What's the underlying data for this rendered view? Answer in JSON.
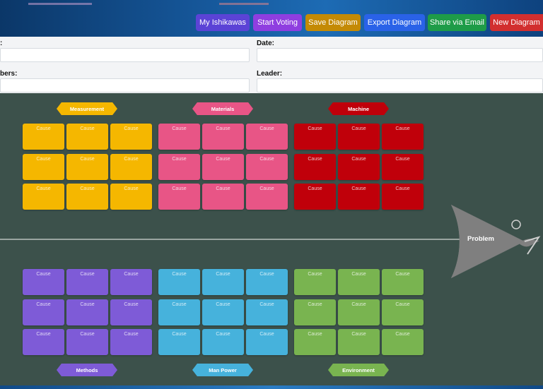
{
  "toolbar": {
    "my_ishikawas": "My Ishikawas",
    "start_voting": "Start Voting",
    "save_diagram": "Save Diagram",
    "export_diagram": "Export Diagram",
    "share_email": "Share via Email",
    "new_diagram": "New Diagram"
  },
  "form": {
    "date_label": "Date:",
    "leader_label": "Leader:",
    "members_label": "bers:",
    "cut_label": ":"
  },
  "categories": {
    "measurement": "Measurement",
    "materials": "Materials",
    "machine": "Machine",
    "methods": "Methods",
    "man_power": "Man Power",
    "environment": "Environment"
  },
  "cause_label": "Cause",
  "problem_label": "Problem",
  "colors": {
    "measurement": "#f5b700",
    "materials": "#e85586",
    "machine": "#c0000a",
    "methods": "#7e5bd7",
    "man_power": "#46b2dc",
    "environment": "#79b450",
    "board": "#3c514b"
  }
}
